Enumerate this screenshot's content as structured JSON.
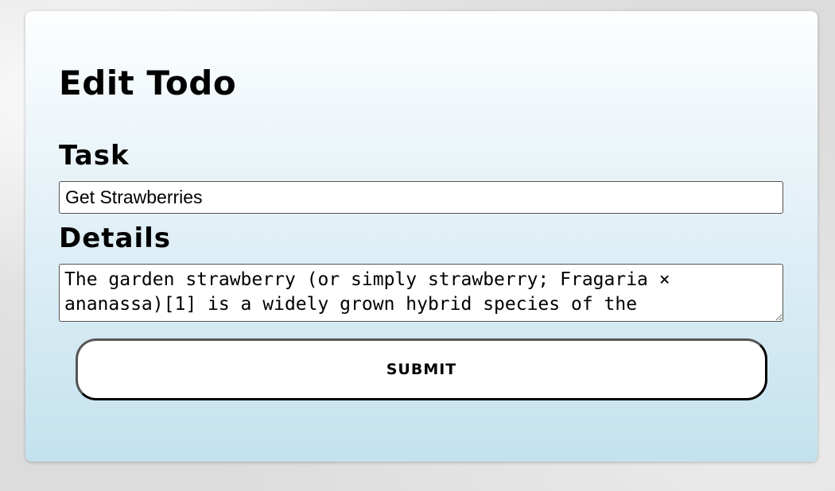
{
  "form": {
    "title": "Edit Todo",
    "task_label": "Task",
    "task_value": "Get Strawberries",
    "details_label": "Details",
    "details_value": "The garden strawberry (or simply strawberry; Fragaria × ananassa)[1] is a widely grown hybrid species of the",
    "submit_label": "SUBMIT"
  }
}
